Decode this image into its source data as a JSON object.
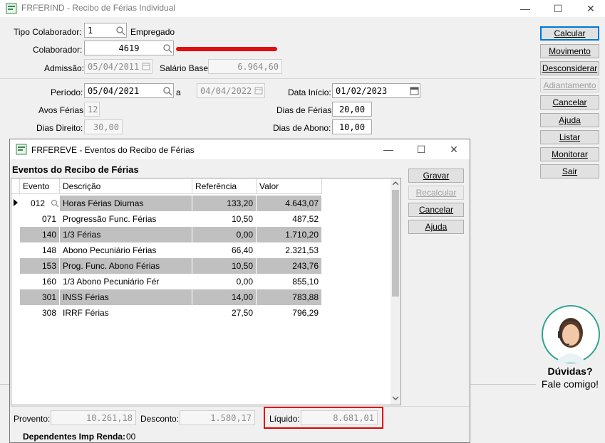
{
  "main_window": {
    "title": "FRFERIND - Recibo de Férias Individual",
    "controls": {
      "minimize": "—",
      "maximize": "☐",
      "close": "✕"
    }
  },
  "form": {
    "tipo_colaborador_label": "Tipo Colaborador:",
    "tipo_colaborador_value": "1",
    "tipo_colaborador_desc": "Empregado",
    "colaborador_label": "Colaborador:",
    "colaborador_value": "4619",
    "admissao_label": "Admissão:",
    "admissao_value": "05/04/2011",
    "salario_base_label": "Salário Base:",
    "salario_base_value": "6.964,60",
    "periodo_label": "Período:",
    "periodo_inicio": "05/04/2021",
    "periodo_a": "a",
    "periodo_fim": "04/04/2022",
    "data_inicio_label": "Data Início:",
    "data_inicio_value": "01/02/2023",
    "avos_ferias_label": "Avos Férias:",
    "avos_ferias_value": "12",
    "dias_ferias_label": "Dias de Férias:",
    "dias_ferias_value": "20,00",
    "dias_direito_label": "Dias Direito:",
    "dias_direito_value": "30,00",
    "dias_abono_label": "Dias de Abono:",
    "dias_abono_value": "10,00"
  },
  "side_buttons": [
    "Calcular",
    "Movimento",
    "Desconsiderar",
    "Adiantamento",
    "Cancelar",
    "Ajuda",
    "Listar",
    "Monitorar",
    "Sair"
  ],
  "help_widget": {
    "line1": "Dúvidas?",
    "line2": "Fale comigo!"
  },
  "modal": {
    "title": "FRFEREVE - Eventos do Recibo de Férias",
    "section_title": "Eventos do Recibo de Férias",
    "controls": {
      "minimize": "—",
      "maximize": "☐",
      "close": "✕"
    },
    "columns": [
      "Evento",
      "Descrição",
      "Referência",
      "Valor"
    ],
    "rows": [
      {
        "evento": "012",
        "descricao": "Horas Férias Diurnas",
        "referencia": "133,20",
        "valor": "4.643,07"
      },
      {
        "evento": "071",
        "descricao": "Progressão Func. Férias",
        "referencia": "10,50",
        "valor": "487,52"
      },
      {
        "evento": "140",
        "descricao": "1/3 Férias",
        "referencia": "0,00",
        "valor": "1.710,20"
      },
      {
        "evento": "148",
        "descricao": "Abono Pecuniário Férias",
        "referencia": "66,40",
        "valor": "2.321,53"
      },
      {
        "evento": "153",
        "descricao": "Prog. Func. Abono Férias",
        "referencia": "10,50",
        "valor": "243,76"
      },
      {
        "evento": "160",
        "descricao": "1/3 Abono Pecuniário Fér",
        "referencia": "0,00",
        "valor": "855,10"
      },
      {
        "evento": "301",
        "descricao": "INSS Férias",
        "referencia": "14,00",
        "valor": "783,88"
      },
      {
        "evento": "308",
        "descricao": "IRRF Férias",
        "referencia": "27,50",
        "valor": "796,29"
      }
    ],
    "buttons": [
      "Gravar",
      "Recalcular",
      "Cancelar",
      "Ajuda"
    ],
    "proventos_label": "Provento:",
    "proventos_value": "10.261,18",
    "desconto_label": "Desconto:",
    "desconto_value": "1.580,17",
    "liquido_label": "Líquido:",
    "liquido_value": "8.681,01",
    "dependentes_label": "Dependentes Imp Renda:",
    "dependentes_value": "00"
  },
  "colors": {
    "accent": "#0078d7",
    "row_shade": "#c0c0c0",
    "highlight": "#e10000"
  }
}
